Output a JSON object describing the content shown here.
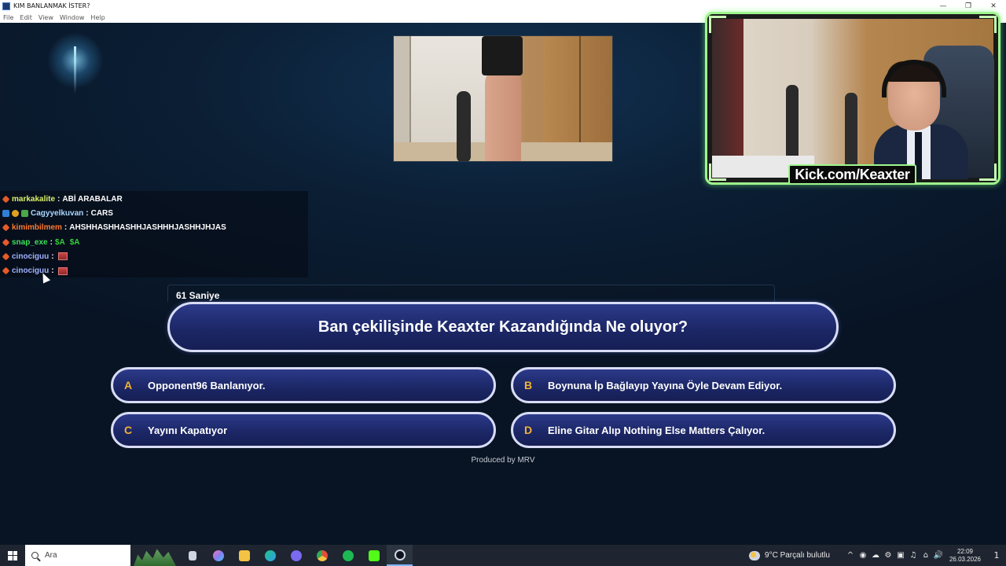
{
  "window": {
    "title": "KIM BANLANMAK İSTER?",
    "controls": {
      "minimize": "—",
      "maximize": "❐",
      "close": "✕"
    }
  },
  "menu": [
    "File",
    "Edit",
    "View",
    "Window",
    "Help"
  ],
  "stream": {
    "channel_label": "Kick.com/Keaxter"
  },
  "chat": [
    {
      "badges": [
        "fire"
      ],
      "user": "markakalite",
      "user_color": "#d8f06a",
      "message": "ABİ ARABALAR"
    },
    {
      "badges": [
        "blue",
        "gold",
        "green"
      ],
      "user": "Cagyyelkuvan",
      "user_color": "#a9d7ff",
      "message": "CARS"
    },
    {
      "badges": [
        "fire"
      ],
      "user": "kimimbilmem",
      "user_color": "#ff7a2e",
      "message": "AHSHHASHHASHHJASHHHJASHHJHJAS"
    },
    {
      "badges": [
        "fire"
      ],
      "user": "snap_exe",
      "user_color": "#3ee05a",
      "message": "",
      "emotes_text": [
        "$A",
        "$A"
      ]
    },
    {
      "badges": [
        "fire"
      ],
      "user": "cinociguu",
      "user_color": "#9fb2ff",
      "message": "",
      "emote": "emote-image"
    },
    {
      "badges": [
        "fire"
      ],
      "user": "cinociguu",
      "user_color": "#9fb2ff",
      "message": "",
      "emote": "emote-image"
    }
  ],
  "quiz": {
    "timer": "61 Saniye",
    "question": "Ban çekilişinde Keaxter Kazandığında Ne oluyor?",
    "answers": [
      {
        "letter": "A",
        "text": "Opponent96 Banlanıyor."
      },
      {
        "letter": "B",
        "text": "Boynuna İp Bağlayıp Yayına Öyle Devam Ediyor."
      },
      {
        "letter": "C",
        "text": "Yayını Kapatıyor"
      },
      {
        "letter": "D",
        "text": "Eline Gitar Alıp Nothing Else Matters Çalıyor."
      }
    ],
    "credit": "Produced by MRV"
  },
  "taskbar": {
    "search_placeholder": "Ara",
    "apps": [
      {
        "name": "task-view-icon",
        "color": "#cfd6e0"
      },
      {
        "name": "copilot-icon",
        "color": "#8a7cf0"
      },
      {
        "name": "file-explorer-icon",
        "color": "#f5c344"
      },
      {
        "name": "edge-icon",
        "color": "#2fa0e6"
      },
      {
        "name": "discord-icon",
        "color": "#7a6af0"
      },
      {
        "name": "chrome-icon",
        "color": "#e84b3c"
      },
      {
        "name": "spotify-icon",
        "color": "#1db954"
      },
      {
        "name": "kick-app-icon",
        "color": "#53fc18"
      },
      {
        "name": "obs-icon",
        "color": "#3a6fd0"
      }
    ],
    "weather": "9°C  Parçalı bulutlu",
    "tray_icons": [
      "^",
      "◉",
      "☁",
      "⚙",
      "▣",
      "♫",
      "⌂",
      "🔊"
    ],
    "time": "22:09",
    "date": "26.03.2026",
    "notifications": "1"
  }
}
